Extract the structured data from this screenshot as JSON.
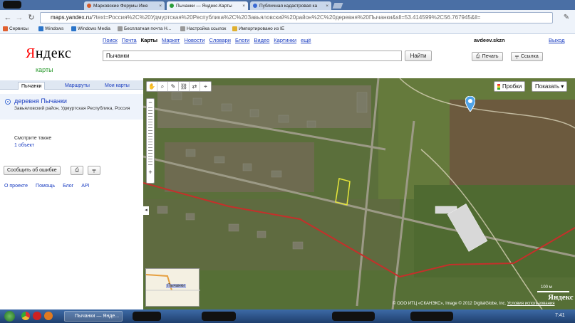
{
  "browser": {
    "tabs": [
      {
        "label": "Марковские Форумы Иже",
        "active": false,
        "favicon_color": "#d35a2a"
      },
      {
        "label": "Пычанки — Яндекс.Карты",
        "active": true,
        "favicon_color": "#2a9d3a"
      },
      {
        "label": "Публичная кадастровая ка",
        "active": false,
        "favicon_color": "#3a6ad4"
      }
    ],
    "url_host": "maps.yandex.ru",
    "url_rest": "/?text=Россия%2C%20Удмуртская%20Республика%2C%20Завьяловский%20район%2C%20деревня%20Пычанки&sll=53.414599%2C56.767945&ll=",
    "bookmarks": [
      {
        "label": "Сервисы",
        "color": "#e06030"
      },
      {
        "label": "Windows",
        "color": "#2a74c9"
      },
      {
        "label": "Windows Media",
        "color": "#2a74c9"
      },
      {
        "label": "Бесплатная почта Н...",
        "color": "#999"
      },
      {
        "label": "Настройка ссылок",
        "color": "#999"
      },
      {
        "label": "Импортировано из IE",
        "color": "#e0b030"
      }
    ]
  },
  "header": {
    "logo_first": "Я",
    "logo_rest": "ндекс",
    "service_name": "карты",
    "services": [
      {
        "label": "Поиск",
        "current": false
      },
      {
        "label": "Почта",
        "current": false
      },
      {
        "label": "Карты",
        "current": true
      },
      {
        "label": "Маркет",
        "current": false
      },
      {
        "label": "Новости",
        "current": false
      },
      {
        "label": "Словари",
        "current": false
      },
      {
        "label": "Блоги",
        "current": false
      },
      {
        "label": "Видео",
        "current": false
      },
      {
        "label": "Картинки",
        "current": false
      },
      {
        "label": "ещё",
        "current": false
      }
    ],
    "search_value": "Пычанки",
    "search_button": "Найти",
    "username": "avdeev.skzn",
    "logout": "Выход",
    "print_button": "Печать",
    "link_button": "Ссылка"
  },
  "sidebar": {
    "tabs": [
      "Пычанки",
      "Маршруты",
      "Мои карты"
    ],
    "result_title": "деревня Пычанки",
    "result_address": "Завьяловский район, Удмуртская Республика, Россия",
    "see_also_label": "Смотрите также",
    "see_also_count": "1 объект",
    "report_error_button": "Сообщить об ошибке",
    "footer_links": [
      "О проекте",
      "Помощь",
      "Блог",
      "API"
    ]
  },
  "map": {
    "traffic_button": "Пробки",
    "show_button": "Показать",
    "minimap_label": "Пычанки",
    "scale_label": "100 м",
    "copyright": "© ООО ИТЦ «СКАНЭКС», Image © 2012 DigitalGlobe, Inc.",
    "terms_link": "Условия использования",
    "yandex_mark": "Яндекс"
  },
  "taskbar": {
    "task_label": "Пычанки — Яндe...",
    "clock": "7:41"
  }
}
